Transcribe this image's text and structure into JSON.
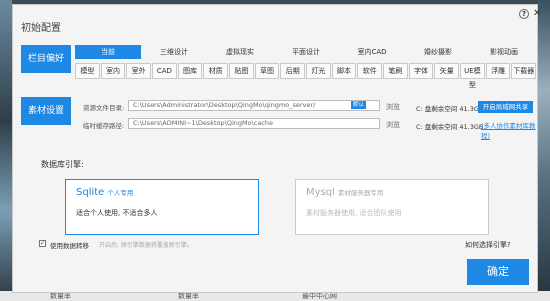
{
  "dialog": {
    "title": "初始配置",
    "help_symbol": "?",
    "close_symbol": "✕"
  },
  "sections": {
    "preferences": "栏目偏好",
    "materials": "素材设置"
  },
  "main_tabs": [
    "当前",
    "三维设计",
    "虚拟现实",
    "平面设计",
    "室内CAD",
    "婚纱摄影",
    "影视动画"
  ],
  "sub_tabs": [
    "模型",
    "室内",
    "室外",
    "CAD",
    "图库",
    "材质",
    "贴图",
    "草图",
    "后期",
    "灯光",
    "脚本",
    "软件",
    "笔刷",
    "字体",
    "矢量",
    "UE模型",
    "浮雕",
    "下载器"
  ],
  "storage": {
    "material_dir_label": "资源文件目录:",
    "material_dir_value": "C:\\Users\\Administrator\\Desktop\\QingMo\\qingmo_server/",
    "material_dir_tag": "默认",
    "cache_dir_label": "临时缓存路径:",
    "cache_dir_value": "C:\\Users\\ADMINI~1\\Desktop\\QingMo\\cache",
    "browse_label": "浏览",
    "disk_free_1": "C: 盘剩余空间 41.3GB",
    "disk_free_2": "C: 盘剩余空间 41.3GB",
    "lan_button": "开启局域网共享",
    "help_link": "(多人协作素材库教程)"
  },
  "database": {
    "heading": "数据库引擎:",
    "sqlite_name": "Sqlite",
    "sqlite_tag": "个人专用",
    "sqlite_desc": "适合个人使用, 不适合多人",
    "mysql_name": "Mysql",
    "mysql_tag": "素材服务器专用",
    "mysql_desc": "素材服务器使用, 适合团队使用"
  },
  "options": {
    "checked_symbol": "✓",
    "migrate_label": "使用数据转移",
    "migrate_hint": "开启后, 原引擎数据将覆盖新引擎。",
    "how_choose": "如何选择引擎?"
  },
  "ok_button": "确定",
  "background": {
    "col1": "数量率",
    "col2": "数量率",
    "col3": "最中中心网"
  }
}
